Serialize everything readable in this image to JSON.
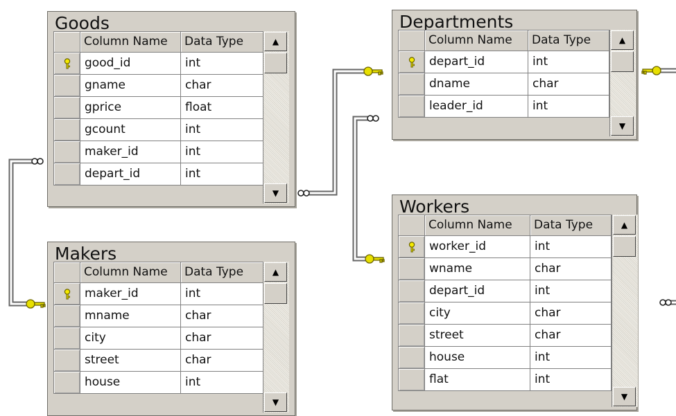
{
  "header_labels": {
    "column_name": "Column Name",
    "data_type": "Data Type"
  },
  "tables": {
    "goods": {
      "title": "Goods",
      "columns": [
        {
          "name": "good_id",
          "type": "int",
          "pk": true
        },
        {
          "name": "gname",
          "type": "char"
        },
        {
          "name": "gprice",
          "type": "float"
        },
        {
          "name": "gcount",
          "type": "int"
        },
        {
          "name": "maker_id",
          "type": "int"
        },
        {
          "name": "depart_id",
          "type": "int"
        }
      ]
    },
    "makers": {
      "title": "Makers",
      "columns": [
        {
          "name": "maker_id",
          "type": "int",
          "pk": true
        },
        {
          "name": "mname",
          "type": "char"
        },
        {
          "name": "city",
          "type": "char"
        },
        {
          "name": "street",
          "type": "char"
        },
        {
          "name": "house",
          "type": "int"
        }
      ]
    },
    "departments": {
      "title": "Departments",
      "columns": [
        {
          "name": "depart_id",
          "type": "int",
          "pk": true
        },
        {
          "name": "dname",
          "type": "char"
        },
        {
          "name": "leader_id",
          "type": "int"
        }
      ]
    },
    "workers": {
      "title": "Workers",
      "columns": [
        {
          "name": "worker_id",
          "type": "int",
          "pk": true
        },
        {
          "name": "wname",
          "type": "char"
        },
        {
          "name": "depart_id",
          "type": "int"
        },
        {
          "name": "city",
          "type": "char"
        },
        {
          "name": "street",
          "type": "char"
        },
        {
          "name": "house",
          "type": "int"
        },
        {
          "name": "flat",
          "type": "int"
        }
      ]
    }
  },
  "relationships": [
    {
      "from": "goods.maker_id",
      "to": "makers.maker_id",
      "type": "many-to-one"
    },
    {
      "from": "goods.depart_id",
      "to": "departments.depart_id",
      "type": "many-to-one"
    },
    {
      "from": "departments.leader_id",
      "to": "workers.worker_id",
      "type": "many-to-one"
    },
    {
      "from": "workers.depart_id",
      "to": "departments.depart_id",
      "type": "many-to-one"
    }
  ],
  "colors": {
    "key": "#e8e000",
    "key_outline": "#6b6400",
    "canvas": "#ffffff",
    "table_bg": "#d4d0c8"
  }
}
